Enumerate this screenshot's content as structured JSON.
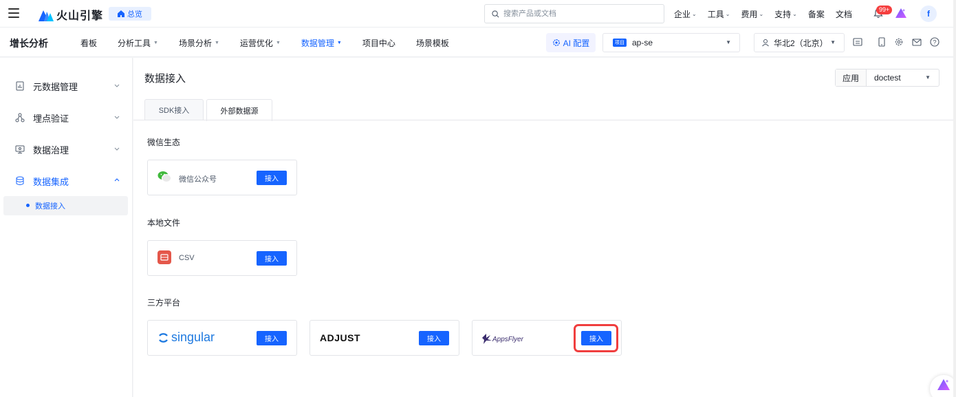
{
  "topbar": {
    "brand": "火山引擎",
    "overview": "总览",
    "search_placeholder": "搜索产品或文档",
    "links": [
      {
        "label": "企业",
        "chevron": true
      },
      {
        "label": "工具",
        "chevron": true
      },
      {
        "label": "费用",
        "chevron": true
      },
      {
        "label": "支持",
        "chevron": true
      },
      {
        "label": "备案",
        "chevron": false
      },
      {
        "label": "文档",
        "chevron": false
      }
    ],
    "notification_count": "99+",
    "avatar_letter": "f"
  },
  "navbar": {
    "product": "增长分析",
    "items": [
      {
        "label": "看板",
        "dropdown": false,
        "active": false
      },
      {
        "label": "分析工具",
        "dropdown": true,
        "active": false
      },
      {
        "label": "场景分析",
        "dropdown": true,
        "active": false
      },
      {
        "label": "运营优化",
        "dropdown": true,
        "active": false
      },
      {
        "label": "数据管理",
        "dropdown": true,
        "active": true
      },
      {
        "label": "项目中心",
        "dropdown": true,
        "active": false
      },
      {
        "label": "场景模板",
        "dropdown": false,
        "active": false
      }
    ],
    "ai_config": "AI 配置",
    "project_tag": "项目",
    "project_name": "ap-se",
    "region": "华北2（北京）"
  },
  "sidebar": {
    "groups": [
      {
        "label": "元数据管理",
        "icon": "chart-doc-icon",
        "expanded": false
      },
      {
        "label": "埋点验证",
        "icon": "nodes-icon",
        "expanded": false
      },
      {
        "label": "数据治理",
        "icon": "monitor-icon",
        "expanded": false
      },
      {
        "label": "数据集成",
        "icon": "database-icon",
        "expanded": true
      }
    ],
    "active_sub": "数据接入"
  },
  "main": {
    "title": "数据接入",
    "app_label": "应用",
    "app_value": "doctest",
    "tabs": [
      "SDK接入",
      "外部数据源"
    ],
    "active_tab": 1,
    "sections": [
      {
        "title": "微信生态",
        "cards": [
          {
            "name": "微信公众号",
            "logo": "wechat-icon",
            "button": "接入"
          }
        ]
      },
      {
        "title": "本地文件",
        "cards": [
          {
            "name": "CSV",
            "logo": "csv-icon",
            "button": "接入"
          }
        ]
      },
      {
        "title": "三方平台",
        "cards": [
          {
            "name": "singular",
            "logo": "singular-logo",
            "button": "接入"
          },
          {
            "name": "ADJUST",
            "logo": "adjust-logo",
            "button": "接入"
          },
          {
            "name": "AppsFlyer",
            "logo": "appsflyer-logo",
            "button": "接入"
          }
        ]
      }
    ]
  },
  "colors": {
    "accent": "#1664ff",
    "highlight": "#f03e3e",
    "badge": "#f53f3f"
  }
}
